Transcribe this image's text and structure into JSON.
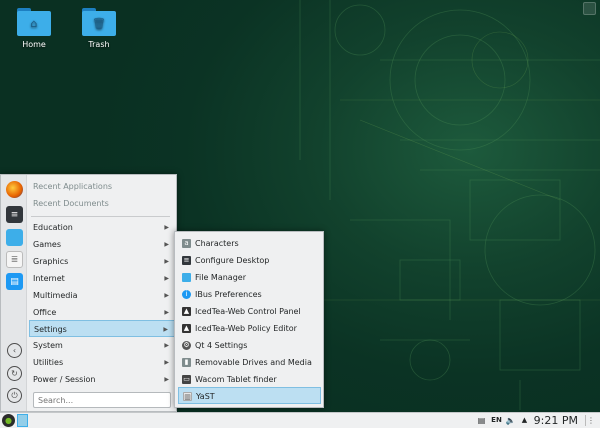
{
  "desktop": {
    "icons": [
      {
        "label": "Home",
        "icon": "home-folder-icon"
      },
      {
        "label": "Trash",
        "icon": "trash-folder-icon"
      }
    ]
  },
  "launcher": {
    "recent": [
      "Recent Applications",
      "Recent Documents"
    ],
    "categories": [
      {
        "label": "Education"
      },
      {
        "label": "Games"
      },
      {
        "label": "Graphics"
      },
      {
        "label": "Internet"
      },
      {
        "label": "Multimedia"
      },
      {
        "label": "Office"
      },
      {
        "label": "Settings",
        "selected": true
      },
      {
        "label": "System"
      },
      {
        "label": "Utilities"
      },
      {
        "label": "Power / Session"
      }
    ],
    "search_placeholder": "Search...",
    "favorites": [
      "firefox-icon",
      "settings-panel-icon",
      "file-manager-icon",
      "document-icon",
      "software-store-icon"
    ],
    "controls": [
      "back-icon",
      "refresh-icon",
      "power-icon"
    ]
  },
  "submenu": {
    "items": [
      {
        "label": "Characters"
      },
      {
        "label": "Configure Desktop"
      },
      {
        "label": "File Manager"
      },
      {
        "label": "IBus Preferences"
      },
      {
        "label": "IcedTea-Web Control Panel"
      },
      {
        "label": "IcedTea-Web Policy Editor"
      },
      {
        "label": "Qt 4 Settings"
      },
      {
        "label": "Removable Drives and Media"
      },
      {
        "label": "Wacom Tablet finder"
      },
      {
        "label": "YaST",
        "selected": true
      }
    ]
  },
  "panel": {
    "keyboard_layout": "EN",
    "clock": "9:21 PM"
  },
  "colors": {
    "accent": "#3daee9",
    "selection": "#bcdff2",
    "desktop": "#0b3324"
  }
}
